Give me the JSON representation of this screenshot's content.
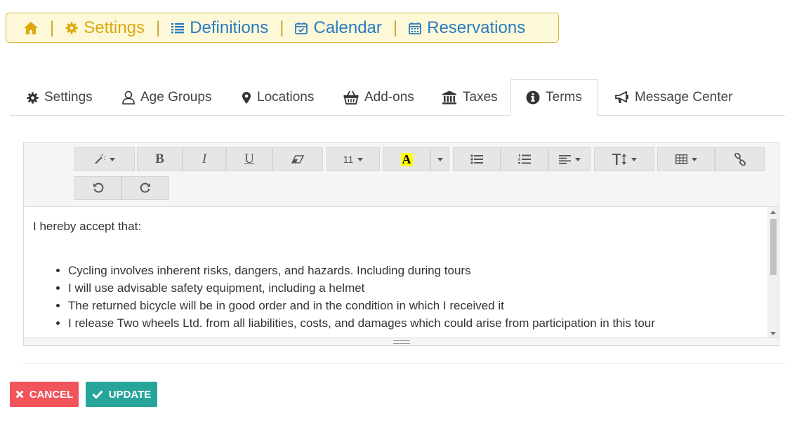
{
  "topnav": {
    "items": [
      {
        "label": "",
        "icon": "home-icon",
        "color": "#dba90e"
      },
      {
        "label": "Settings",
        "icon": "gear-icon",
        "color": "#dba90e"
      },
      {
        "label": "Definitions",
        "icon": "list-icon",
        "color": "#2a7bc2"
      },
      {
        "label": "Calendar",
        "icon": "calendar-check-icon",
        "color": "#2a7bc2"
      },
      {
        "label": "Reservations",
        "icon": "calendar-grid-icon",
        "color": "#2a7bc2"
      }
    ],
    "separator": "|"
  },
  "tabs": [
    {
      "label": "Settings",
      "icon": "gear-icon",
      "active": false
    },
    {
      "label": "Age Groups",
      "icon": "user-icon",
      "active": false
    },
    {
      "label": "Locations",
      "icon": "map-marker-icon",
      "active": false
    },
    {
      "label": "Add-ons",
      "icon": "basket-icon",
      "active": false
    },
    {
      "label": "Taxes",
      "icon": "bank-icon",
      "active": false
    },
    {
      "label": "Terms",
      "icon": "info-circle-icon",
      "active": true
    },
    {
      "label": "Message Center",
      "icon": "bullhorn-icon",
      "active": false
    }
  ],
  "toolbar": {
    "bold": "B",
    "italic": "I",
    "underline": "U",
    "font_size": "11",
    "font_color_letter": "A",
    "highlight_color": "#ffff00"
  },
  "editor": {
    "intro": "I hereby accept that:",
    "items": [
      "Cycling involves inherent risks, dangers, and hazards. Including during tours",
      "I will use advisable safety equipment, including a helmet",
      "The returned bicycle will be in good order and in the condition in which I received it",
      "I release Two wheels Ltd. from all liabilities, costs, and damages which could arise from participation in this tour"
    ]
  },
  "actions": {
    "cancel_label": "CANCEL",
    "update_label": "UPDATE",
    "cancel_color": "#f1545b",
    "update_color": "#27a59a"
  }
}
